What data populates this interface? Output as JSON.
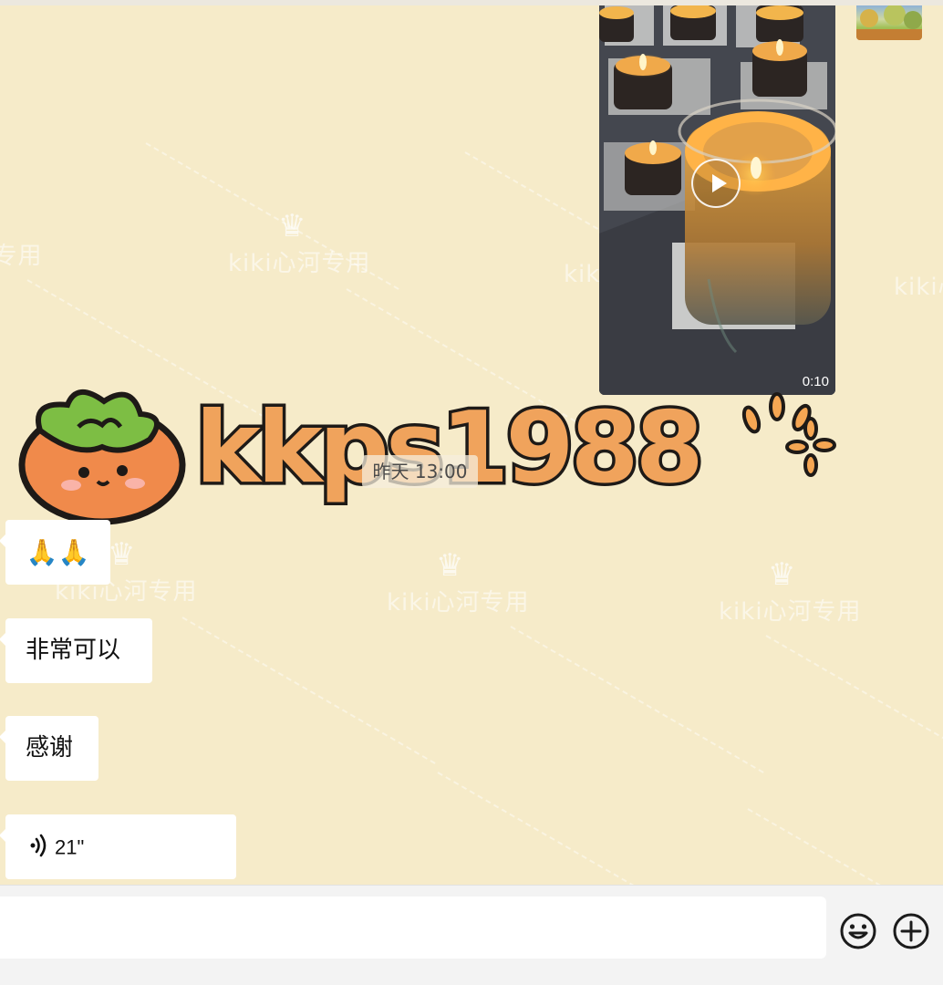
{
  "video": {
    "duration": "0:10"
  },
  "sticker": {
    "word": "kkps1988"
  },
  "timestamp": "昨天 13:00",
  "messages": [
    {
      "kind": "emoji",
      "text": "🙏🙏"
    },
    {
      "kind": "text",
      "text": "非常可以"
    },
    {
      "kind": "text",
      "text": "感谢"
    },
    {
      "kind": "voice",
      "text": "21\""
    }
  ],
  "watermark": {
    "text": "kiki心河专用"
  },
  "icons": {
    "emoji": "emoji-face-icon",
    "plus": "plus-circle-icon",
    "voice": "voice-wave-icon",
    "play": "play-icon"
  },
  "colors": {
    "chat_background": "#f6ebc9",
    "bubble": "#ffffff",
    "input_bar": "#f3f3f3"
  }
}
